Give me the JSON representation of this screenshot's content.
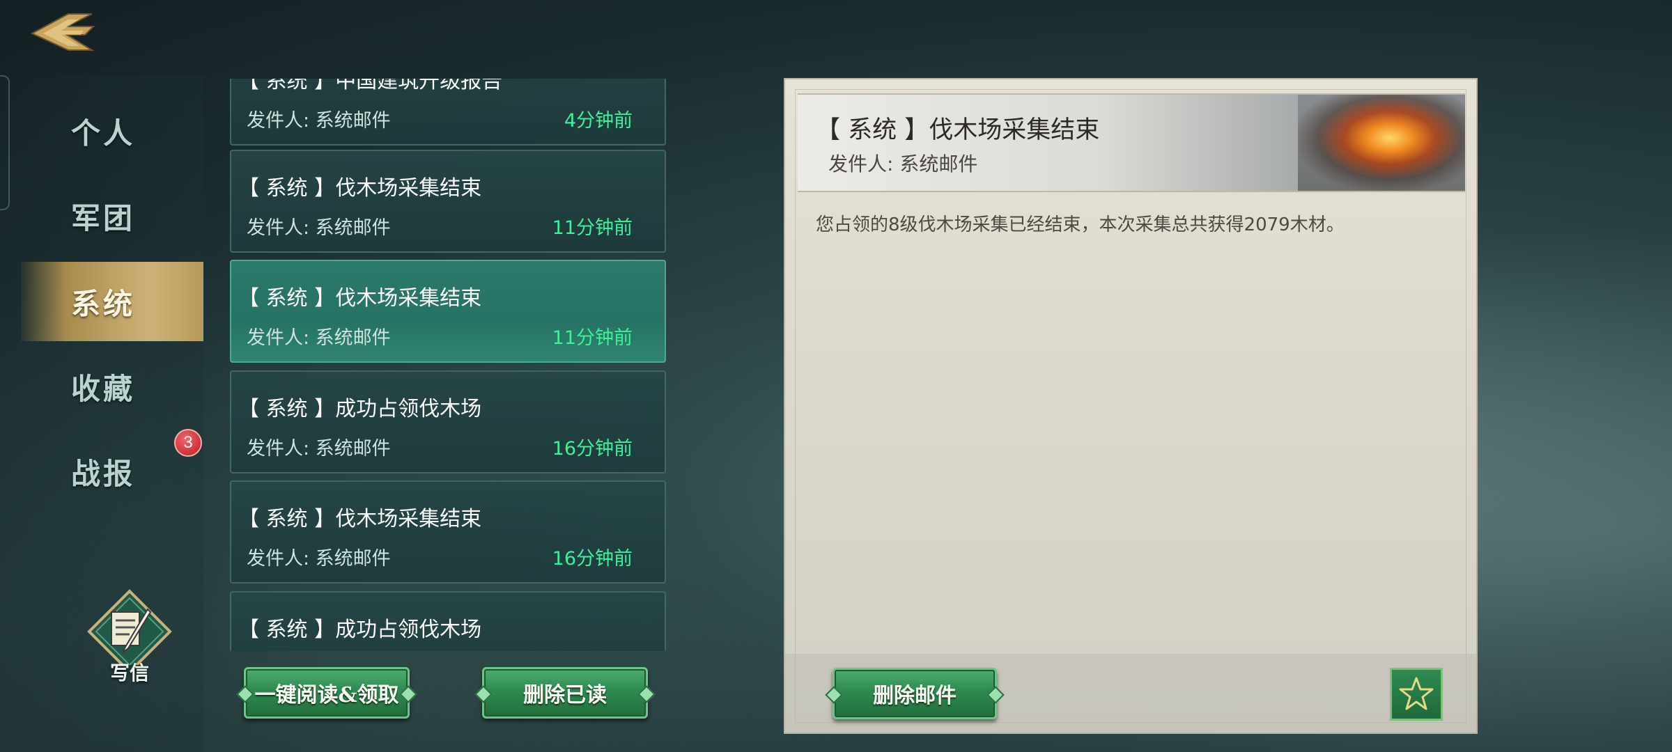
{
  "nav": {
    "items": [
      {
        "label": "个人",
        "active": false
      },
      {
        "label": "军团",
        "active": false
      },
      {
        "label": "系统",
        "active": true
      },
      {
        "label": "收藏",
        "active": false
      },
      {
        "label": "战报",
        "active": false
      }
    ],
    "battle_report_badge": "3",
    "write_label": "写信"
  },
  "mail_list": {
    "items": [
      {
        "title": "【 系统 】中国建筑升级报告",
        "sender": "发件人: 系统邮件",
        "time": "4分钟前",
        "selected": false
      },
      {
        "title": "【 系统 】伐木场采集结束",
        "sender": "发件人: 系统邮件",
        "time": "11分钟前",
        "selected": false
      },
      {
        "title": "【 系统 】伐木场采集结束",
        "sender": "发件人: 系统邮件",
        "time": "11分钟前",
        "selected": true
      },
      {
        "title": "【 系统 】成功占领伐木场",
        "sender": "发件人: 系统邮件",
        "time": "16分钟前",
        "selected": false
      },
      {
        "title": "【 系统 】伐木场采集结束",
        "sender": "发件人: 系统邮件",
        "time": "16分钟前",
        "selected": false
      },
      {
        "title": "【 系统 】成功占领伐木场",
        "sender": "",
        "time": "",
        "selected": false
      }
    ],
    "read_all_label": "一键阅读&领取",
    "delete_read_label": "删除已读"
  },
  "detail": {
    "title": "【 系统 】伐木场采集结束",
    "sender": "发件人: 系统邮件",
    "body": "您占领的8级伐木场采集已经结束，本次采集总共获得2079木材。",
    "delete_label": "删除邮件",
    "favorite_icon": "star-icon"
  },
  "colors": {
    "accent_green": "#3ef09a",
    "active_tab_gold": "#cdb277",
    "badge_red": "#c11a24"
  }
}
